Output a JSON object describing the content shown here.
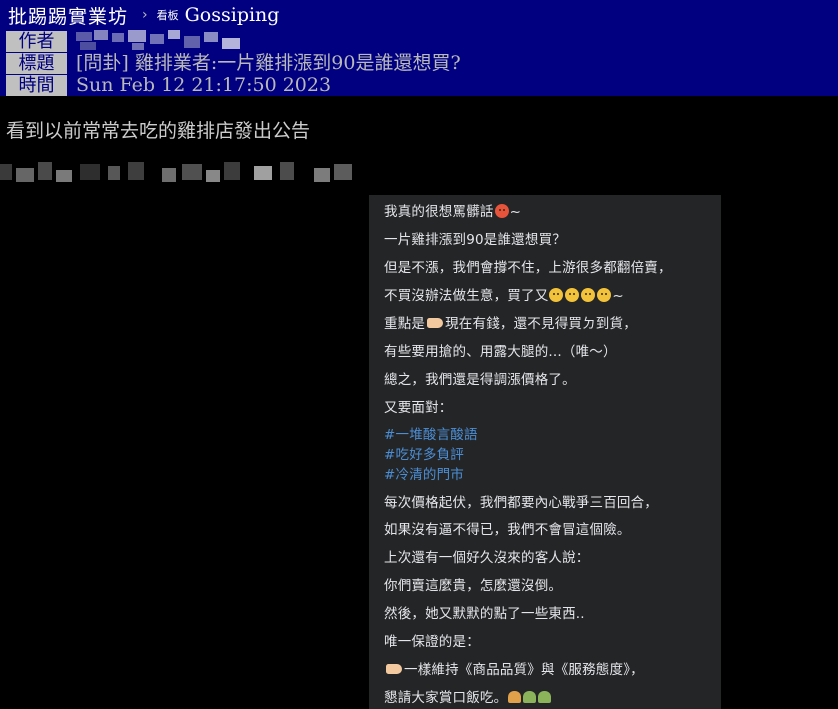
{
  "topbar": {
    "site_name": "批踢踢實業坊",
    "separator": "›",
    "board_label": "看板",
    "board_name": "Gossiping"
  },
  "meta": {
    "author_tag": "作者",
    "title_tag": "標題",
    "title_value": "[問卦] 雞排業者:一片雞排漲到90是誰還想買?",
    "time_tag": "時間",
    "time_value": "Sun Feb 12 21:17:50 2023"
  },
  "post": {
    "lead": "看到以前常常去吃的雞排店發出公告"
  },
  "card": {
    "lines": [
      "我真的很想罵髒話",
      "~",
      "一片雞排漲到90是誰還想買？",
      "但是不漲，我們會撐不住，上游很多都翻倍賣，",
      "不買沒辦法做生意，買了又",
      "~",
      "重點是",
      "現在有錢，還不見得買ㄉ到貨，",
      "有些要用搶的、用露大腿的...（唯～）",
      "總之，我們還是得調漲價格了。",
      "又要面對：",
      "#一堆酸言酸語",
      "#吃好多負評",
      "#冷清的門市",
      "每次價格起伏，我們都要內心戰爭三百回合，",
      "如果沒有逼不得已，我們不會冒這個險。",
      "上次還有一個好久沒來的客人說：",
      "你們賣這麼貴，怎麼還沒倒。",
      "然後，她又默默的點了一些東西..",
      "唯一保證的是：",
      "一樣維持《商品品質》與《服務態度》，",
      "懇請大家賞口飯吃。"
    ]
  },
  "colors": {
    "header_bg": "#000080",
    "tag_bg": "#c0c0c0",
    "tag_text": "#000080",
    "card_bg": "#242526",
    "hashtag": "#4b8ed6"
  }
}
